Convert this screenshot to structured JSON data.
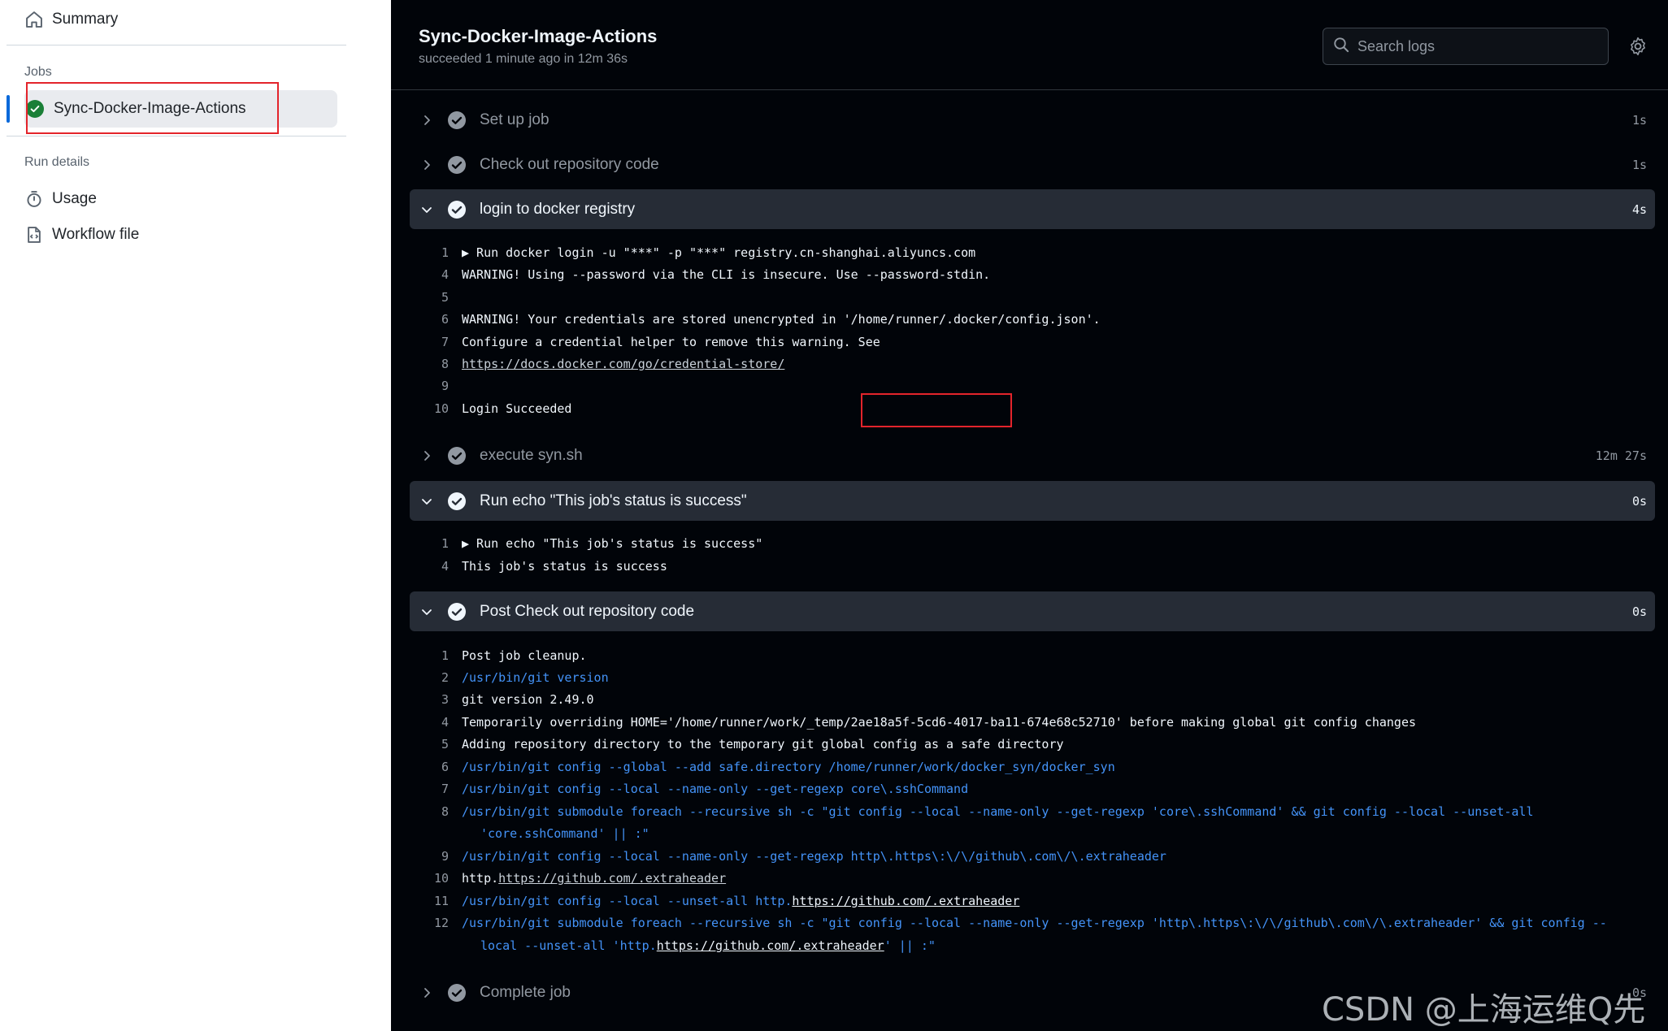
{
  "sidebar": {
    "summary_label": "Summary",
    "jobs_heading": "Jobs",
    "job_label": "Sync-Docker-Image-Actions",
    "run_details_heading": "Run details",
    "usage_label": "Usage",
    "workflow_file_label": "Workflow file"
  },
  "header": {
    "title": "Sync-Docker-Image-Actions",
    "subtitle": "succeeded 1 minute ago in 12m 36s",
    "search_placeholder": "Search logs"
  },
  "steps": [
    {
      "name": "Set up job",
      "duration": "1s"
    },
    {
      "name": "Check out repository code",
      "duration": "1s"
    },
    {
      "name": "login to docker registry",
      "duration": "4s"
    },
    {
      "name": "execute syn.sh",
      "duration": "12m 27s"
    },
    {
      "name": "Run echo \"This job's status is success\"",
      "duration": "0s"
    },
    {
      "name": "Post Check out repository code",
      "duration": "0s"
    },
    {
      "name": "Complete job",
      "duration": "0s"
    }
  ],
  "logs": {
    "login": [
      {
        "n": "1",
        "pre": "▶ Run docker login -u \"***\" -p \"***\" registry.cn-shanghai.aliyuncs.com"
      },
      {
        "n": "4",
        "pre": "WARNING! Using --password via the CLI is insecure. Use --password-stdin."
      },
      {
        "n": "5",
        "pre": ""
      },
      {
        "n": "6",
        "pre": "WARNING! Your credentials are stored unencrypted in '/home/runner/.docker/config.json'."
      },
      {
        "n": "7",
        "pre": "Configure a credential helper to remove this warning. See"
      },
      {
        "n": "8",
        "link": "https://docs.docker.com/go/credential-store/"
      },
      {
        "n": "9",
        "pre": ""
      },
      {
        "n": "10",
        "pre": "Login Succeeded"
      }
    ],
    "echo": [
      {
        "n": "1",
        "pre": "▶ Run echo \"This job's status is success\""
      },
      {
        "n": "4",
        "pre": "This job's status is success"
      }
    ],
    "post": [
      {
        "n": "1",
        "pre": "Post job cleanup."
      },
      {
        "n": "2",
        "pre": "/usr/bin/git version"
      },
      {
        "n": "3",
        "pre": "git version 2.49.0"
      },
      {
        "n": "4",
        "pre": "Temporarily overriding HOME='/home/runner/work/_temp/2ae18a5f-5cd6-4017-ba11-674e68c52710' before making global git config changes"
      },
      {
        "n": "5",
        "pre": "Adding repository directory to the temporary git global config as a safe directory"
      },
      {
        "n": "6",
        "pre": "/usr/bin/git config --global --add safe.directory /home/runner/work/docker_syn/docker_syn"
      },
      {
        "n": "7",
        "pre": "/usr/bin/git config --local --name-only --get-regexp core\\.sshCommand"
      },
      {
        "n": "8",
        "pre": "/usr/bin/git submodule foreach --recursive sh -c \"git config --local --name-only --get-regexp 'core\\.sshCommand' && git config --local --unset-all",
        "cont": "'core.sshCommand' || :\""
      },
      {
        "n": "9",
        "pre": "/usr/bin/git config --local --name-only --get-regexp http\\.https\\:\\/\\/github\\.com\\/\\.extraheader"
      },
      {
        "n": "10",
        "pre": "http.",
        "link": "https://github.com/.extraheader"
      },
      {
        "n": "11",
        "pre": "/usr/bin/git config --local --unset-all http.",
        "link": "https://github.com/.extraheader"
      },
      {
        "n": "12",
        "pre": "/usr/bin/git submodule foreach --recursive sh -c \"git config --local --name-only --get-regexp 'http\\.https\\:\\/\\/github\\.com\\/\\.extraheader' && git config --",
        "cont_pre": "local --unset-all 'http.",
        "cont_link": "https://github.com/.extraheader",
        "cont_post": "' || :\""
      }
    ]
  },
  "watermark": "CSDN @上海运维Q先生",
  "colors": {
    "success": "#1a7f37",
    "accent": "#0969da",
    "annotation": "#e3242b",
    "log_blue": "#4493f8"
  }
}
